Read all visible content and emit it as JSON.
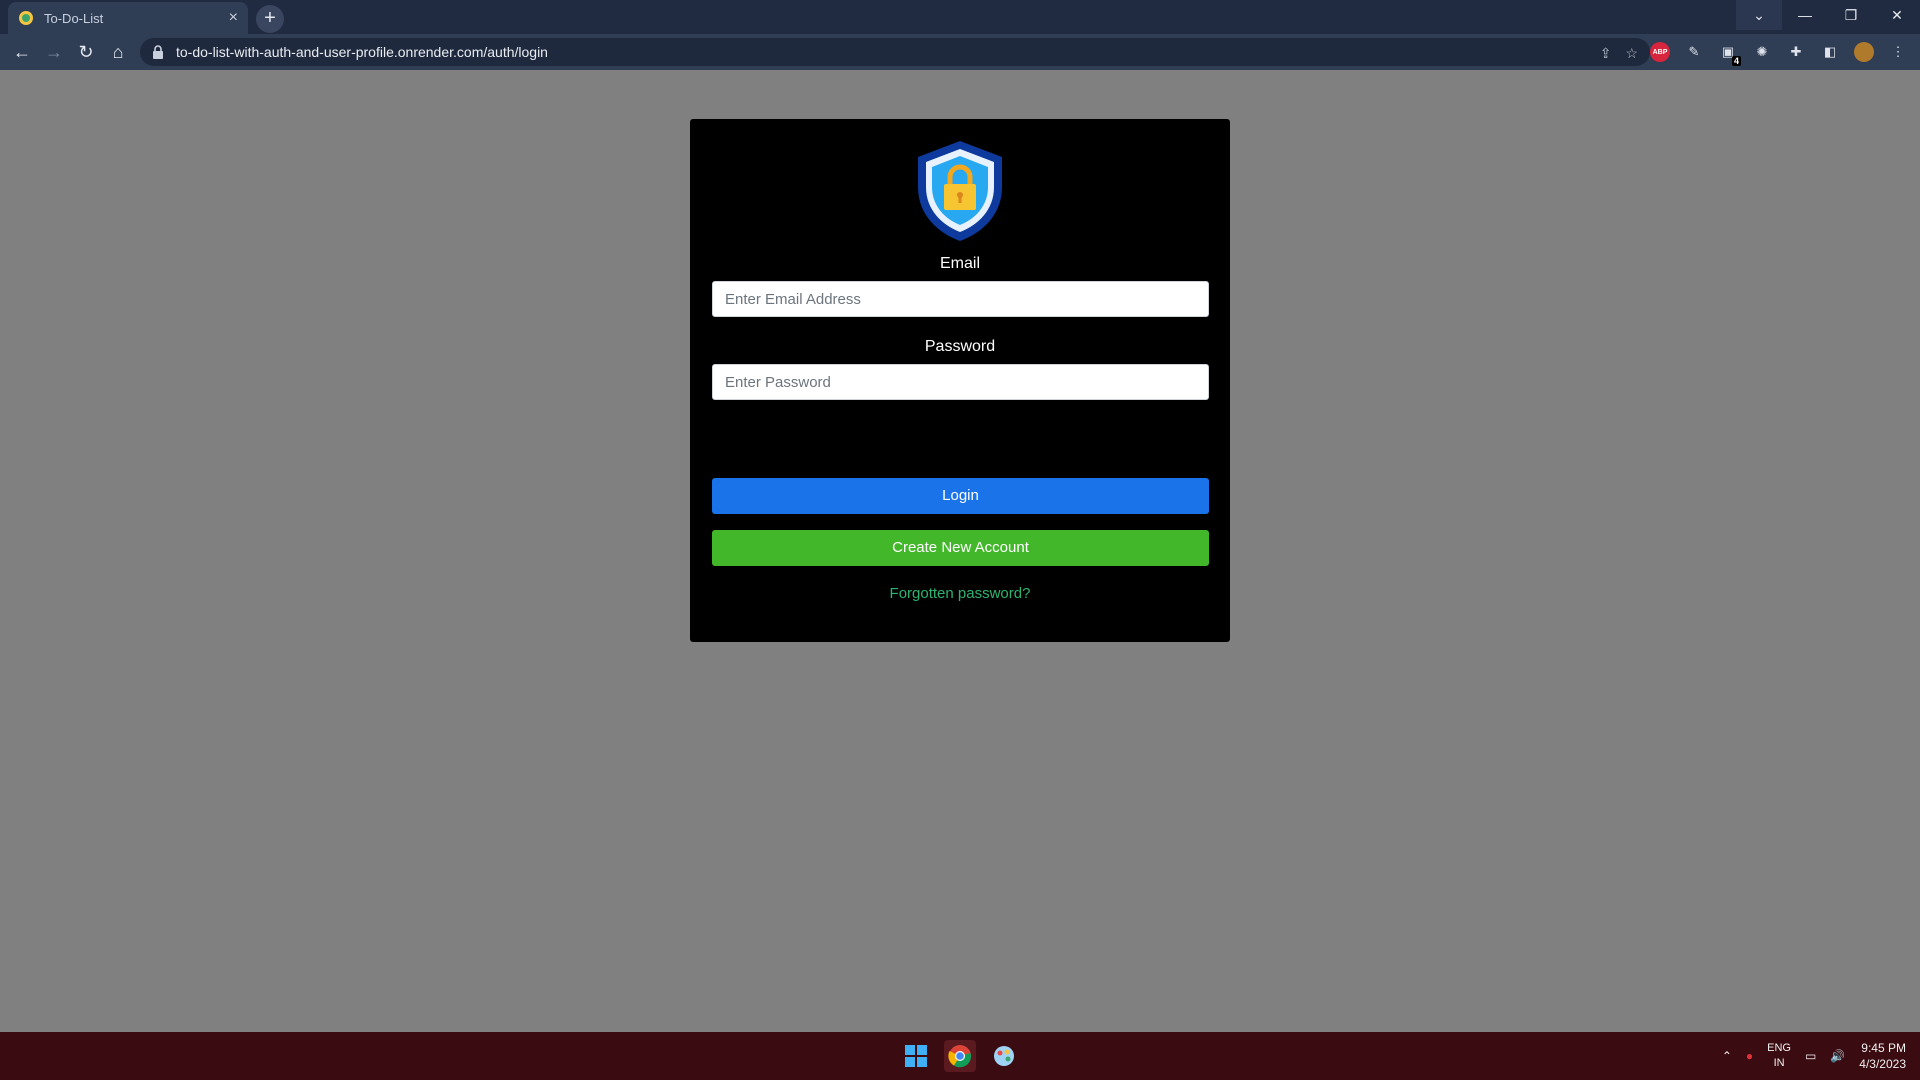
{
  "browser": {
    "tab_title": "To-Do-List",
    "tab_close": "×",
    "new_tab": "+",
    "url": "to-do-list-with-auth-and-user-profile.onrender.com/auth/login",
    "ext_abp_label": "ABP",
    "ext_badge_count": "4"
  },
  "login": {
    "email_label": "Email",
    "email_placeholder": "Enter Email Address",
    "email_value": "",
    "password_label": "Password",
    "password_placeholder": "Enter Password",
    "password_value": "",
    "login_button": "Login",
    "create_button": "Create New Account",
    "forgot_link": "Forgotten password?"
  },
  "taskbar": {
    "lang_top": "ENG",
    "lang_bottom": "IN",
    "time": "9:45 PM",
    "date": "4/3/2023"
  },
  "colors": {
    "page_bg": "#808080",
    "card_bg": "#000000",
    "login_button": "#1a73e8",
    "create_button": "#42b72a",
    "forgot_link": "#2db36f",
    "taskbar_bg": "#3a0b10",
    "browser_chrome": "#2f3d55"
  },
  "icons": {
    "logo": "shield-lock-icon",
    "back": "back-arrow-icon",
    "forward": "forward-arrow-icon",
    "reload": "reload-icon",
    "home": "home-icon",
    "lock": "lock-icon",
    "share": "share-icon",
    "bookmark": "star-icon"
  }
}
